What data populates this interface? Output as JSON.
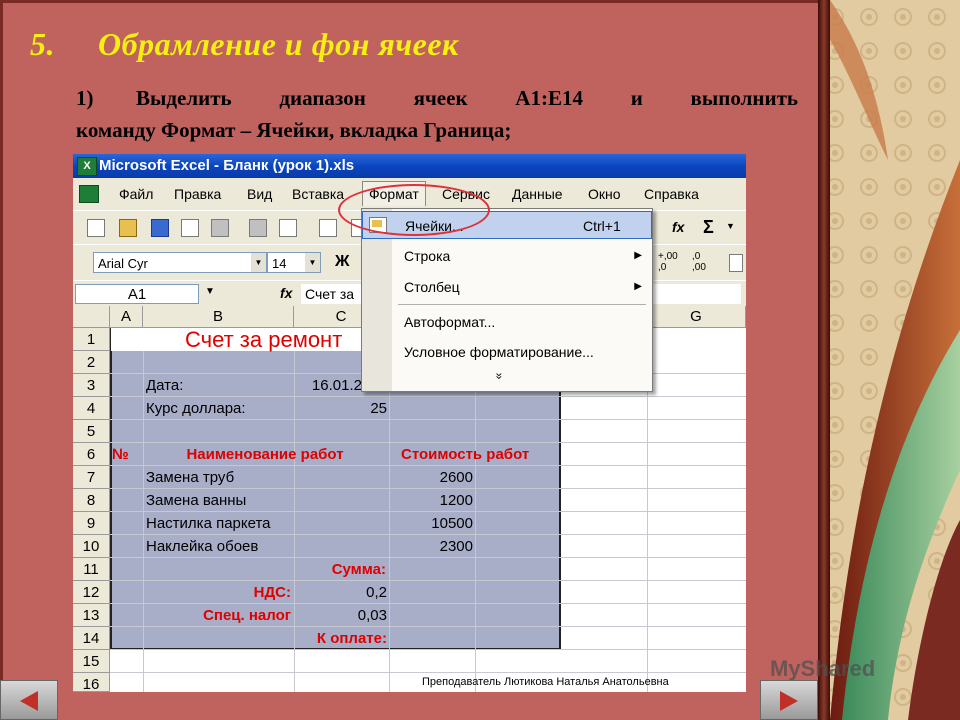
{
  "slide": {
    "title_num": "5.",
    "title_text": "Обрамление и фон ячеек",
    "step_num": "1)",
    "step_line1_words": [
      "Выделить",
      "диапазон",
      "ячеек",
      "A1:E14",
      "и",
      "выполнить"
    ],
    "step_line2": "команду Формат – Ячейки, вкладка Граница;",
    "footer": "Преподаватель Лютикова Наталья Анатольевна",
    "watermark": "MyShared"
  },
  "window": {
    "title": "Microsoft Excel - Бланк (урок 1).xls",
    "app_icon": "X"
  },
  "menubar": {
    "items": [
      "Файл",
      "Правка",
      "Вид",
      "Вставка",
      "Формат",
      "Сервис",
      "Данные",
      "Окно",
      "Справка"
    ],
    "active": "Формат"
  },
  "toolbar": {
    "font_name": "Arial Cyr",
    "font_size": "14",
    "bold_label": "Ж",
    "fx_label": "fx",
    "sum_label": "Σ",
    "decimal_inc": ",00",
    "decimal_dec": ",00"
  },
  "formula_bar": {
    "name_box": "A1",
    "content": "Счет за"
  },
  "grid": {
    "columns": [
      "A",
      "B",
      "C",
      "D",
      "E",
      "F",
      "G"
    ],
    "rows": [
      "1",
      "2",
      "3",
      "4",
      "5",
      "6",
      "7",
      "8",
      "9",
      "10",
      "11",
      "12",
      "13",
      "14",
      "15",
      "16"
    ],
    "cells": {
      "b1": "Счет за ремонт",
      "b3": "Дата:",
      "c3": "16.01.2007",
      "b4": "Курс доллара:",
      "c4": "25",
      "a6": "№",
      "b6": "Наименование работ",
      "d6": "Стоимость работ",
      "b7": "Замена труб",
      "d7": "2600",
      "b8": "Замена ванны",
      "d8": "1200",
      "b9": "Настилка паркета",
      "d9": "10500",
      "b10": "Наклейка обоев",
      "d10": "2300",
      "d11": "Сумма:",
      "b12": "НДС:",
      "c12": "0,2",
      "b13": "Спец. налог",
      "c13": "0,03",
      "d14": "К оплате:"
    }
  },
  "format_menu": {
    "items": [
      {
        "label": "Ячейки...",
        "shortcut": "Ctrl+1",
        "highlighted": true
      },
      {
        "label": "Строка",
        "submenu": true
      },
      {
        "label": "Столбец",
        "submenu": true
      },
      {
        "label": "Автоформат..."
      },
      {
        "label": "Условное форматирование..."
      }
    ],
    "more": "»"
  },
  "colors": {
    "slide_bg": "#c0625e",
    "title": "#f5f010",
    "selection": "#a8aec8",
    "red_text": "#e00000",
    "highlight_circle": "#e0303a"
  }
}
